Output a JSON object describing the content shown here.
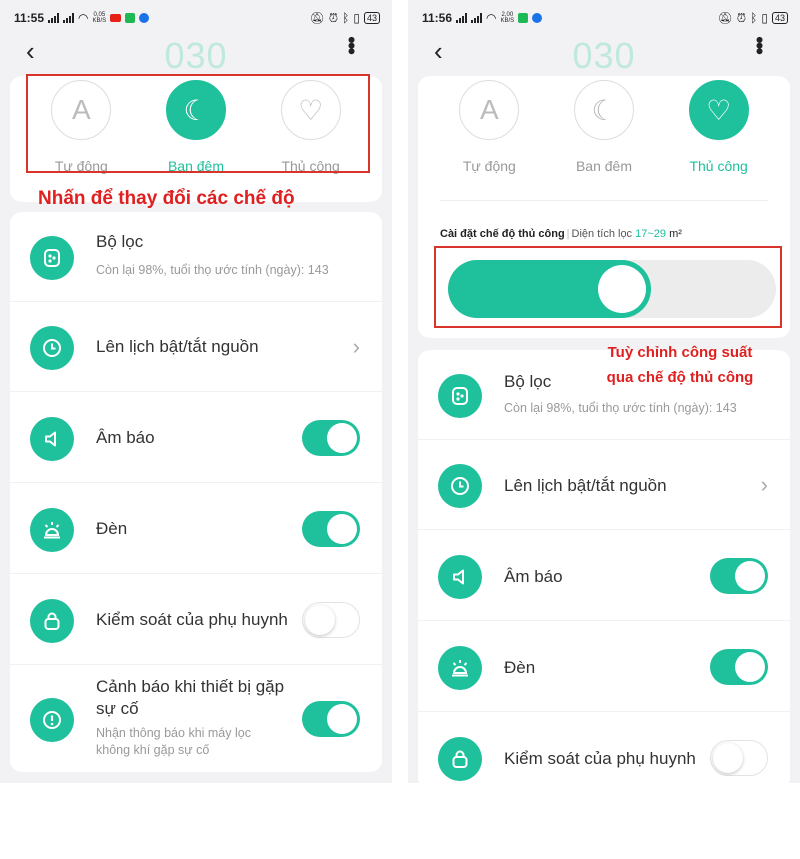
{
  "colors": {
    "accent": "#1fc09c",
    "annotation": "#e02020",
    "title": "#bfe9dc"
  },
  "left": {
    "status": {
      "time": "11:55",
      "speed": "0,05",
      "speed_unit": "KB/S",
      "battery": "43"
    },
    "header": {
      "title": "030"
    },
    "modes": [
      {
        "label": "Tự động",
        "icon": "auto-icon",
        "glyph": "A",
        "active": false
      },
      {
        "label": "Ban đêm",
        "icon": "moon-icon",
        "glyph": "☾",
        "active": true
      },
      {
        "label": "Thủ công",
        "icon": "heart-icon",
        "glyph": "♡",
        "active": false
      }
    ],
    "annotation": "Nhấn để thay đổi các chế độ",
    "settings": {
      "filter": {
        "title": "Bộ lọc",
        "subtitle": "Còn lại 98%, tuổi thọ ước tính (ngày): 143"
      },
      "schedule": {
        "title": "Lên lịch bật/tắt nguồn",
        "chevron": "›"
      },
      "sound": {
        "title": "Âm báo",
        "on": true
      },
      "light": {
        "title": "Đèn",
        "on": true
      },
      "parental": {
        "title": "Kiểm soát của phụ huynh",
        "on": false
      },
      "alert": {
        "title_line1": "Cảnh báo khi thiết bị gặp",
        "title_line2": "sự cố",
        "subtitle_line1": "Nhận thông báo khi máy lọc",
        "subtitle_line2": "không khí gặp sự cố",
        "on": true
      }
    }
  },
  "right": {
    "status": {
      "time": "11:56",
      "speed": "2,00",
      "speed_unit": "KB/S",
      "battery": "43"
    },
    "header": {
      "title": "030"
    },
    "modes": [
      {
        "label": "Tự động",
        "icon": "auto-icon",
        "glyph": "A",
        "active": false
      },
      {
        "label": "Ban đêm",
        "icon": "moon-icon",
        "glyph": "☾",
        "active": false
      },
      {
        "label": "Thủ công",
        "icon": "heart-icon",
        "glyph": "♡",
        "active": true
      }
    ],
    "manual": {
      "label": "Cài đặt chế độ thủ công",
      "separator": "|",
      "area_label": "Diện tích lọc",
      "range": "17~29",
      "unit": "m²",
      "level_percent": 62
    },
    "annotation_line1": "Tuỳ chỉnh công suất",
    "annotation_line2": "qua chế độ thủ công",
    "settings": {
      "filter": {
        "title": "Bộ lọc",
        "subtitle": "Còn lại 98%, tuổi thọ ước tính (ngày): 143"
      },
      "schedule": {
        "title": "Lên lịch bật/tắt nguồn",
        "chevron": "›"
      },
      "sound": {
        "title": "Âm báo",
        "on": true
      },
      "light": {
        "title": "Đèn",
        "on": true
      },
      "parental": {
        "title": "Kiểm soát của phụ huynh",
        "on": false
      }
    }
  }
}
